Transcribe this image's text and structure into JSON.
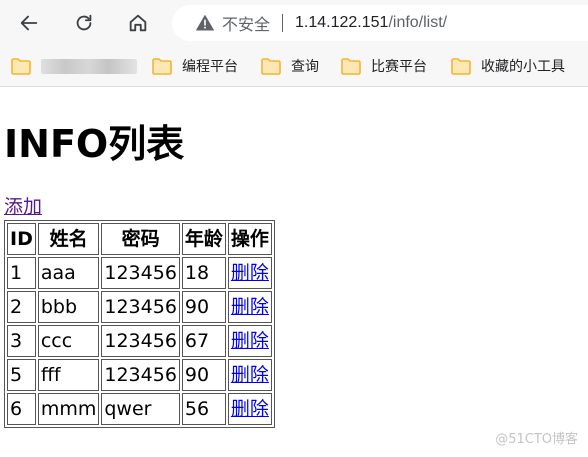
{
  "browser": {
    "address_bar": {
      "security_label": "不安全",
      "url_host": "1.14.122.151",
      "url_path": "/info/list/"
    },
    "bookmarks": [
      {
        "label": "编程平台"
      },
      {
        "label": "查询"
      },
      {
        "label": "比赛平台"
      },
      {
        "label": "收藏的小工具"
      }
    ],
    "colors": {
      "toolbar": "#f7f7f7",
      "folder": "#f2b535",
      "link": "#0000ee",
      "visited_link": "#551a8b"
    }
  },
  "page": {
    "heading": "INFO列表",
    "add_link": "添加",
    "table": {
      "headers": [
        "ID",
        "姓名",
        "密码",
        "年龄",
        "操作"
      ],
      "rows": [
        {
          "id": "1",
          "name": "aaa",
          "password": "123456",
          "age": "18",
          "action": "删除"
        },
        {
          "id": "2",
          "name": "bbb",
          "password": "123456",
          "age": "90",
          "action": "删除"
        },
        {
          "id": "3",
          "name": "ccc",
          "password": "123456",
          "age": "67",
          "action": "删除"
        },
        {
          "id": "5",
          "name": "fff",
          "password": "123456",
          "age": "90",
          "action": "删除"
        },
        {
          "id": "6",
          "name": "mmm",
          "password": "qwer",
          "age": "56",
          "action": "删除"
        }
      ]
    }
  },
  "watermark": "@51CTO博客"
}
